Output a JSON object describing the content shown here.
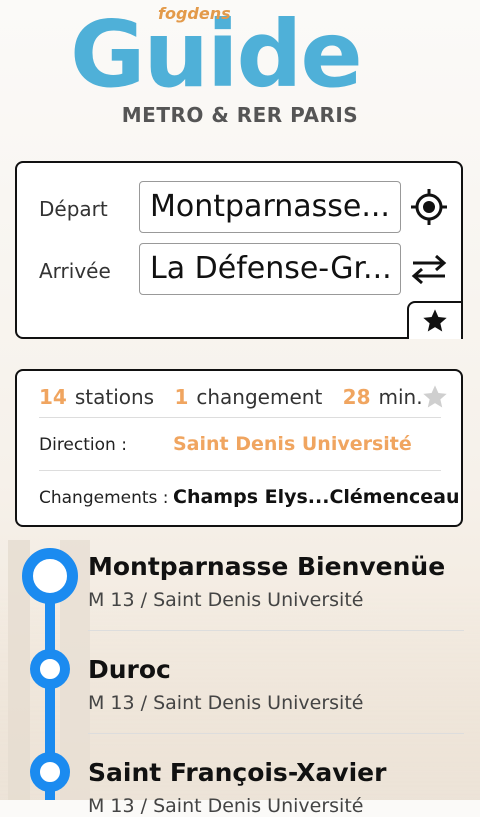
{
  "header": {
    "brand": "fogdens",
    "logo_text": "Guide",
    "subtitle": "METRO & RER PARIS"
  },
  "route_form": {
    "depart_label": "Départ",
    "depart_value": "Montparnasse...",
    "arrivee_label": "Arrivée",
    "arrivee_value": "La Défense-Gr..."
  },
  "summary": {
    "stations_count": "14",
    "stations_label": "stations",
    "changes_count": "1",
    "changes_label": "changement",
    "duration": "28",
    "duration_unit": "min.",
    "direction_label": "Direction :",
    "direction_value": "Saint Denis Université",
    "changes_row_label": "Changements :",
    "changes_row_value": "Champs Elys...Clémenceau"
  },
  "stops": [
    {
      "name": "Montparnasse Bienvenüe",
      "line": "M 13 / Saint Denis Université"
    },
    {
      "name": "Duroc",
      "line": "M 13 / Saint Denis Université"
    },
    {
      "name": "Saint François-Xavier",
      "line": "M 13 / Saint Denis Université"
    }
  ],
  "colors": {
    "accent_orange": "#f0a560",
    "logo_blue": "#4fb0d8",
    "line_blue": "#1b8bf0"
  },
  "icons": {
    "locate": "crosshair-icon",
    "swap": "swap-icon",
    "favorite": "star-icon"
  }
}
